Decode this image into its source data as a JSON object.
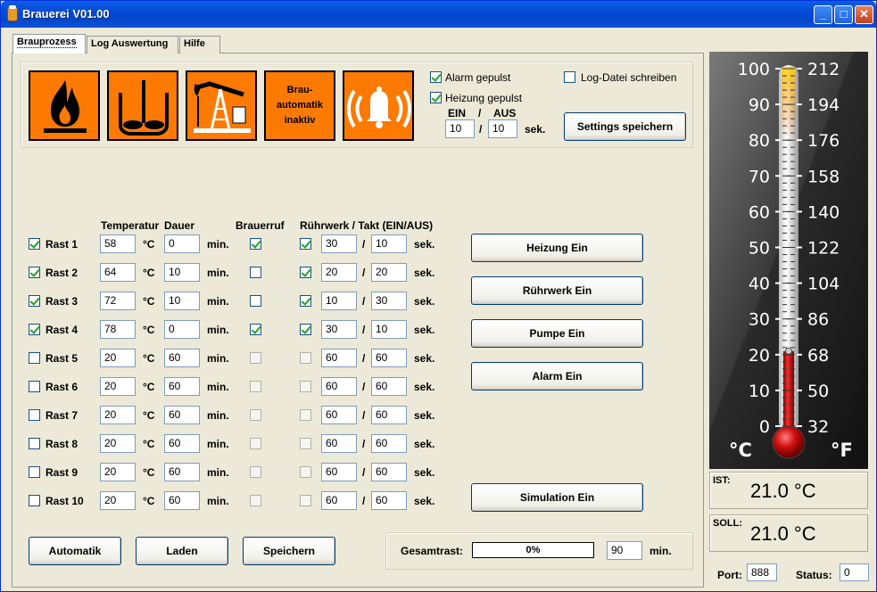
{
  "window": {
    "title": "Brauerei V01.00",
    "controls": {
      "minimize": "_",
      "maximize": "□",
      "close": "✕"
    }
  },
  "tabs": [
    {
      "label": "Brauprozess",
      "active": true
    },
    {
      "label": "Log Auswertung"
    },
    {
      "label": "Hilfe"
    }
  ],
  "warning_icons": [
    {
      "icon": "flame-icon"
    },
    {
      "icon": "stirrer-icon"
    },
    {
      "icon": "pump-jack-icon"
    },
    {
      "icon": "text-sign",
      "text_lines": [
        "Brau-",
        "automatik",
        "inaktiv"
      ]
    },
    {
      "icon": "alarm-bell-icon"
    }
  ],
  "options": {
    "alarm_gepulst": {
      "label": "Alarm gepulst",
      "checked": true
    },
    "heizung_gepulst": {
      "label": "Heizung gepulst",
      "checked": true
    },
    "logfile": {
      "label": "Log-Datei schreiben",
      "checked": false
    },
    "ein_label": "EIN",
    "slash": "/",
    "aus_label": "AUS",
    "ein_value": "10",
    "aus_value": "10",
    "unit": "sek.",
    "settings_button": "Settings speichern"
  },
  "headers": {
    "temperatur": "Temperatur",
    "dauer": "Dauer",
    "brauerruf": "Brauerruf",
    "ruehrwerk": "Rührwerk / Takt (EIN/AUS)"
  },
  "units": {
    "celsius": "°C",
    "min": "min.",
    "sek": "sek.",
    "slash": "/"
  },
  "rasts": [
    {
      "label": "Rast 1",
      "enabled": true,
      "temp": "58",
      "dauer": "0",
      "brauerruf": true,
      "ruehr": true,
      "ein": "30",
      "aus": "10"
    },
    {
      "label": "Rast 2",
      "enabled": true,
      "temp": "64",
      "dauer": "10",
      "brauerruf": false,
      "ruehr": true,
      "ein": "20",
      "aus": "20"
    },
    {
      "label": "Rast 3",
      "enabled": true,
      "temp": "72",
      "dauer": "10",
      "brauerruf": false,
      "ruehr": true,
      "ein": "10",
      "aus": "30"
    },
    {
      "label": "Rast 4",
      "enabled": true,
      "temp": "78",
      "dauer": "0",
      "brauerruf": true,
      "ruehr": true,
      "ein": "30",
      "aus": "10"
    },
    {
      "label": "Rast 5",
      "enabled": false,
      "temp": "20",
      "dauer": "60",
      "brauerruf": false,
      "ruehr": false,
      "ein": "60",
      "aus": "60"
    },
    {
      "label": "Rast 6",
      "enabled": false,
      "temp": "20",
      "dauer": "60",
      "brauerruf": false,
      "ruehr": false,
      "ein": "60",
      "aus": "60"
    },
    {
      "label": "Rast 7",
      "enabled": false,
      "temp": "20",
      "dauer": "60",
      "brauerruf": false,
      "ruehr": false,
      "ein": "60",
      "aus": "60"
    },
    {
      "label": "Rast 8",
      "enabled": false,
      "temp": "20",
      "dauer": "60",
      "brauerruf": false,
      "ruehr": false,
      "ein": "60",
      "aus": "60"
    },
    {
      "label": "Rast 9",
      "enabled": false,
      "temp": "20",
      "dauer": "60",
      "brauerruf": false,
      "ruehr": false,
      "ein": "60",
      "aus": "60"
    },
    {
      "label": "Rast 10",
      "enabled": false,
      "temp": "20",
      "dauer": "60",
      "brauerruf": false,
      "ruehr": false,
      "ein": "60",
      "aus": "60"
    }
  ],
  "actions": {
    "heizung": "Heizung Ein",
    "ruehrwerk": "Rührwerk Ein",
    "pumpe": "Pumpe Ein",
    "alarm": "Alarm Ein",
    "simulation": "Simulation Ein"
  },
  "bottom": {
    "automatik": "Automatik",
    "laden": "Laden",
    "speichern": "Speichern",
    "gesamtrast_label": "Gesamtrast:",
    "progress_text": "0%",
    "progress": 0,
    "total": "90",
    "unit": "min."
  },
  "thermometer": {
    "celsius_ticks": [
      "100",
      "90",
      "80",
      "70",
      "60",
      "50",
      "40",
      "30",
      "20",
      "10",
      "0"
    ],
    "fahrenheit_ticks": [
      "212",
      "194",
      "176",
      "158",
      "140",
      "122",
      "104",
      "86",
      "68",
      "50",
      "32"
    ],
    "c_unit": "°C",
    "f_unit": "°F",
    "current_c": 21.0,
    "set_c": 21.0
  },
  "readings": {
    "ist_label": "IST:",
    "ist_value": "21.0 °C",
    "soll_label": "SOLL:",
    "soll_value": "21.0 °C"
  },
  "status_bar": {
    "port_label": "Port:",
    "port_value": "888",
    "status_label": "Status:",
    "status_value": "0"
  }
}
